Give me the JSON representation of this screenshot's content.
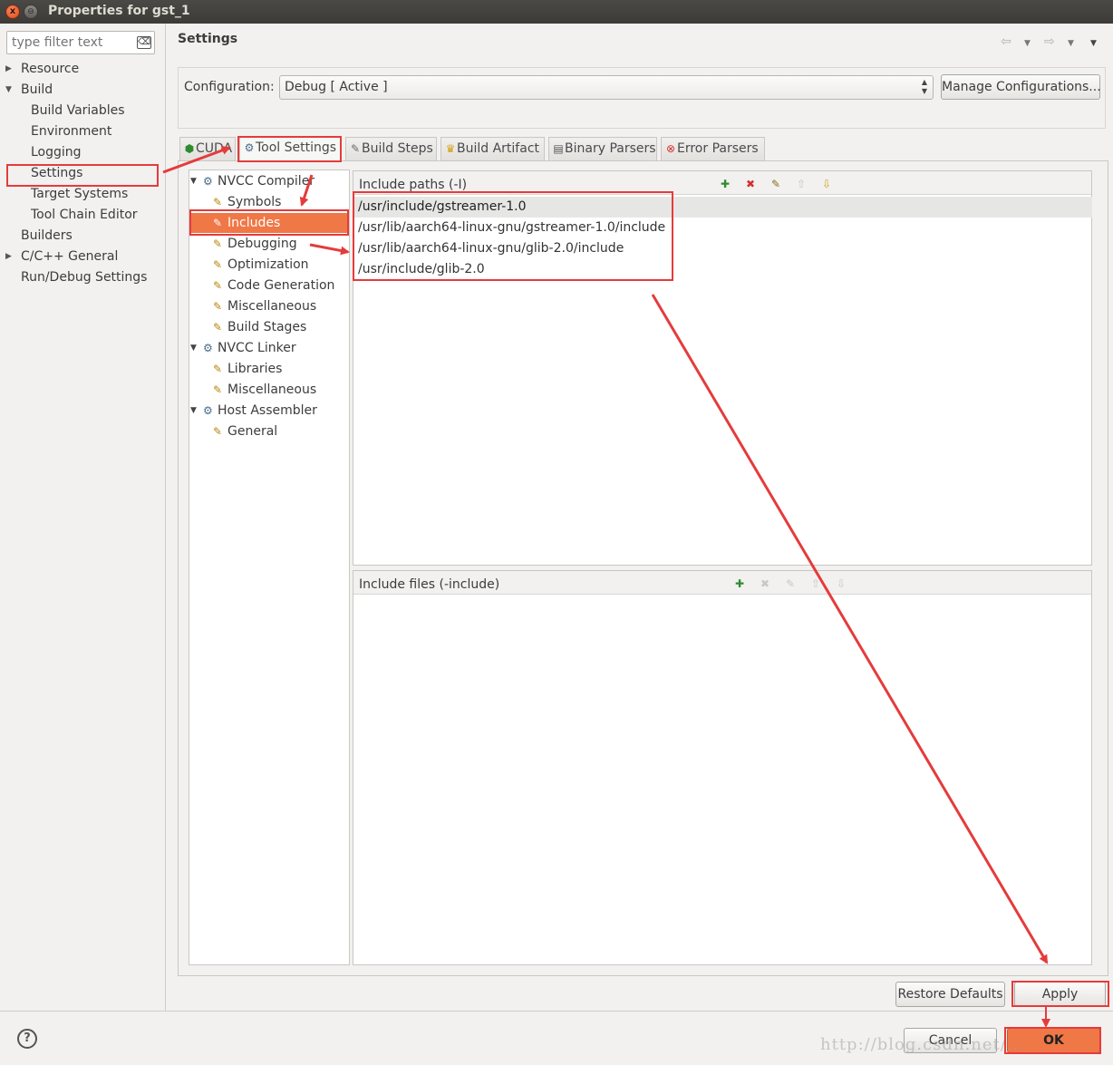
{
  "window": {
    "title": "Properties for gst_1",
    "close_glyph": "x",
    "min_glyph": "⊖"
  },
  "filter": {
    "placeholder": "type filter text"
  },
  "sidebar": {
    "items": [
      {
        "label": "Resource"
      },
      {
        "label": "Build"
      },
      {
        "label": "Build Variables"
      },
      {
        "label": "Environment"
      },
      {
        "label": "Logging"
      },
      {
        "label": "Settings"
      },
      {
        "label": "Target Systems"
      },
      {
        "label": "Tool Chain Editor"
      },
      {
        "label": "Builders"
      },
      {
        "label": "C/C++ General"
      },
      {
        "label": "Run/Debug Settings"
      }
    ]
  },
  "header": {
    "title": "Settings"
  },
  "configuration": {
    "label": "Configuration:",
    "value": "Debug  [ Active ]",
    "manage_label": "Manage Configurations..."
  },
  "tabs": [
    {
      "label": "CUDA",
      "icon": "cuda-icon"
    },
    {
      "label": "Tool Settings",
      "icon": "tool-settings-icon"
    },
    {
      "label": "Build Steps",
      "icon": "build-steps-icon"
    },
    {
      "label": "Build Artifact",
      "icon": "build-artifact-icon"
    },
    {
      "label": "Binary Parsers",
      "icon": "binary-parsers-icon"
    },
    {
      "label": "Error Parsers",
      "icon": "error-parsers-icon"
    }
  ],
  "tool_tree": {
    "items": [
      {
        "label": "NVCC Compiler"
      },
      {
        "label": "Symbols"
      },
      {
        "label": "Includes"
      },
      {
        "label": "Debugging"
      },
      {
        "label": "Optimization"
      },
      {
        "label": "Code Generation"
      },
      {
        "label": "Miscellaneous"
      },
      {
        "label": "Build Stages"
      },
      {
        "label": "NVCC Linker"
      },
      {
        "label": "Libraries"
      },
      {
        "label": "Miscellaneous"
      },
      {
        "label": "Host Assembler"
      },
      {
        "label": "General"
      }
    ]
  },
  "include_paths": {
    "title": "Include paths (-I)",
    "rows": [
      "/usr/include/gstreamer-1.0",
      "/usr/lib/aarch64-linux-gnu/gstreamer-1.0/include",
      "/usr/lib/aarch64-linux-gnu/glib-2.0/include",
      "/usr/include/glib-2.0"
    ]
  },
  "include_files": {
    "title": "Include files (-include)"
  },
  "buttons": {
    "restore_defaults": "Restore Defaults",
    "apply": "Apply",
    "cancel": "Cancel",
    "ok": "OK"
  },
  "help_glyph": "?",
  "watermark": "http://blog.csdn.net/...",
  "colors": {
    "selection": "#f07746",
    "highlight": "#e53b3b",
    "ok_button": "#f07746"
  }
}
